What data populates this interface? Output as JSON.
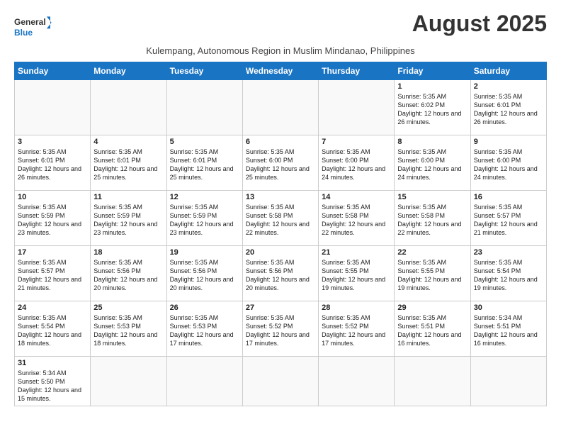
{
  "header": {
    "logo_general": "General",
    "logo_blue": "Blue",
    "month_title": "August 2025",
    "subtitle": "Kulempang, Autonomous Region in Muslim Mindanao, Philippines"
  },
  "days_of_week": [
    "Sunday",
    "Monday",
    "Tuesday",
    "Wednesday",
    "Thursday",
    "Friday",
    "Saturday"
  ],
  "weeks": [
    [
      {
        "day": "",
        "info": ""
      },
      {
        "day": "",
        "info": ""
      },
      {
        "day": "",
        "info": ""
      },
      {
        "day": "",
        "info": ""
      },
      {
        "day": "",
        "info": ""
      },
      {
        "day": "1",
        "info": "Sunrise: 5:35 AM\nSunset: 6:02 PM\nDaylight: 12 hours and 26 minutes."
      },
      {
        "day": "2",
        "info": "Sunrise: 5:35 AM\nSunset: 6:01 PM\nDaylight: 12 hours and 26 minutes."
      }
    ],
    [
      {
        "day": "3",
        "info": "Sunrise: 5:35 AM\nSunset: 6:01 PM\nDaylight: 12 hours and 26 minutes."
      },
      {
        "day": "4",
        "info": "Sunrise: 5:35 AM\nSunset: 6:01 PM\nDaylight: 12 hours and 25 minutes."
      },
      {
        "day": "5",
        "info": "Sunrise: 5:35 AM\nSunset: 6:01 PM\nDaylight: 12 hours and 25 minutes."
      },
      {
        "day": "6",
        "info": "Sunrise: 5:35 AM\nSunset: 6:00 PM\nDaylight: 12 hours and 25 minutes."
      },
      {
        "day": "7",
        "info": "Sunrise: 5:35 AM\nSunset: 6:00 PM\nDaylight: 12 hours and 24 minutes."
      },
      {
        "day": "8",
        "info": "Sunrise: 5:35 AM\nSunset: 6:00 PM\nDaylight: 12 hours and 24 minutes."
      },
      {
        "day": "9",
        "info": "Sunrise: 5:35 AM\nSunset: 6:00 PM\nDaylight: 12 hours and 24 minutes."
      }
    ],
    [
      {
        "day": "10",
        "info": "Sunrise: 5:35 AM\nSunset: 5:59 PM\nDaylight: 12 hours and 23 minutes."
      },
      {
        "day": "11",
        "info": "Sunrise: 5:35 AM\nSunset: 5:59 PM\nDaylight: 12 hours and 23 minutes."
      },
      {
        "day": "12",
        "info": "Sunrise: 5:35 AM\nSunset: 5:59 PM\nDaylight: 12 hours and 23 minutes."
      },
      {
        "day": "13",
        "info": "Sunrise: 5:35 AM\nSunset: 5:58 PM\nDaylight: 12 hours and 22 minutes."
      },
      {
        "day": "14",
        "info": "Sunrise: 5:35 AM\nSunset: 5:58 PM\nDaylight: 12 hours and 22 minutes."
      },
      {
        "day": "15",
        "info": "Sunrise: 5:35 AM\nSunset: 5:58 PM\nDaylight: 12 hours and 22 minutes."
      },
      {
        "day": "16",
        "info": "Sunrise: 5:35 AM\nSunset: 5:57 PM\nDaylight: 12 hours and 21 minutes."
      }
    ],
    [
      {
        "day": "17",
        "info": "Sunrise: 5:35 AM\nSunset: 5:57 PM\nDaylight: 12 hours and 21 minutes."
      },
      {
        "day": "18",
        "info": "Sunrise: 5:35 AM\nSunset: 5:56 PM\nDaylight: 12 hours and 20 minutes."
      },
      {
        "day": "19",
        "info": "Sunrise: 5:35 AM\nSunset: 5:56 PM\nDaylight: 12 hours and 20 minutes."
      },
      {
        "day": "20",
        "info": "Sunrise: 5:35 AM\nSunset: 5:56 PM\nDaylight: 12 hours and 20 minutes."
      },
      {
        "day": "21",
        "info": "Sunrise: 5:35 AM\nSunset: 5:55 PM\nDaylight: 12 hours and 19 minutes."
      },
      {
        "day": "22",
        "info": "Sunrise: 5:35 AM\nSunset: 5:55 PM\nDaylight: 12 hours and 19 minutes."
      },
      {
        "day": "23",
        "info": "Sunrise: 5:35 AM\nSunset: 5:54 PM\nDaylight: 12 hours and 19 minutes."
      }
    ],
    [
      {
        "day": "24",
        "info": "Sunrise: 5:35 AM\nSunset: 5:54 PM\nDaylight: 12 hours and 18 minutes."
      },
      {
        "day": "25",
        "info": "Sunrise: 5:35 AM\nSunset: 5:53 PM\nDaylight: 12 hours and 18 minutes."
      },
      {
        "day": "26",
        "info": "Sunrise: 5:35 AM\nSunset: 5:53 PM\nDaylight: 12 hours and 17 minutes."
      },
      {
        "day": "27",
        "info": "Sunrise: 5:35 AM\nSunset: 5:52 PM\nDaylight: 12 hours and 17 minutes."
      },
      {
        "day": "28",
        "info": "Sunrise: 5:35 AM\nSunset: 5:52 PM\nDaylight: 12 hours and 17 minutes."
      },
      {
        "day": "29",
        "info": "Sunrise: 5:35 AM\nSunset: 5:51 PM\nDaylight: 12 hours and 16 minutes."
      },
      {
        "day": "30",
        "info": "Sunrise: 5:34 AM\nSunset: 5:51 PM\nDaylight: 12 hours and 16 minutes."
      }
    ],
    [
      {
        "day": "31",
        "info": "Sunrise: 5:34 AM\nSunset: 5:50 PM\nDaylight: 12 hours and 15 minutes."
      },
      {
        "day": "",
        "info": ""
      },
      {
        "day": "",
        "info": ""
      },
      {
        "day": "",
        "info": ""
      },
      {
        "day": "",
        "info": ""
      },
      {
        "day": "",
        "info": ""
      },
      {
        "day": "",
        "info": ""
      }
    ]
  ]
}
